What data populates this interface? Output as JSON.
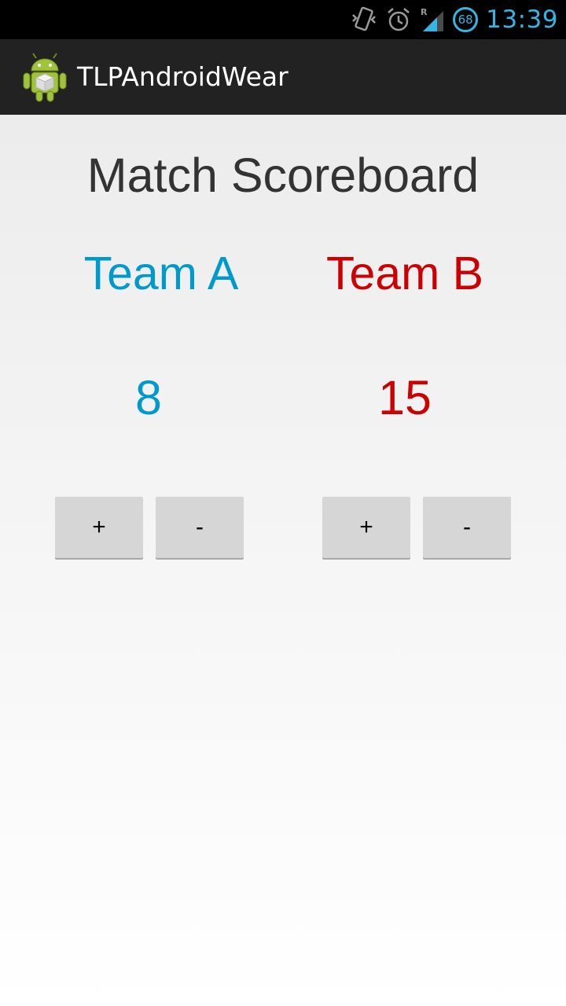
{
  "status_bar": {
    "time": "13:39",
    "battery_level": "68",
    "icons": [
      "vibrate-icon",
      "alarm-icon",
      "signal-roaming-icon",
      "battery-icon"
    ]
  },
  "action_bar": {
    "app_icon": "android-robot-icon",
    "title": "TLPAndroidWear"
  },
  "main": {
    "title": "Match Scoreboard",
    "team_a": {
      "name": "Team A",
      "score": "8",
      "color": "#0099cc",
      "plus_label": "+",
      "minus_label": "-"
    },
    "team_b": {
      "name": "Team B",
      "score": "15",
      "color": "#cc0000",
      "plus_label": "+",
      "minus_label": "-"
    }
  },
  "colors": {
    "accent": "#33b5e5",
    "action_bar": "#222222",
    "button": "#d6d6d6"
  }
}
